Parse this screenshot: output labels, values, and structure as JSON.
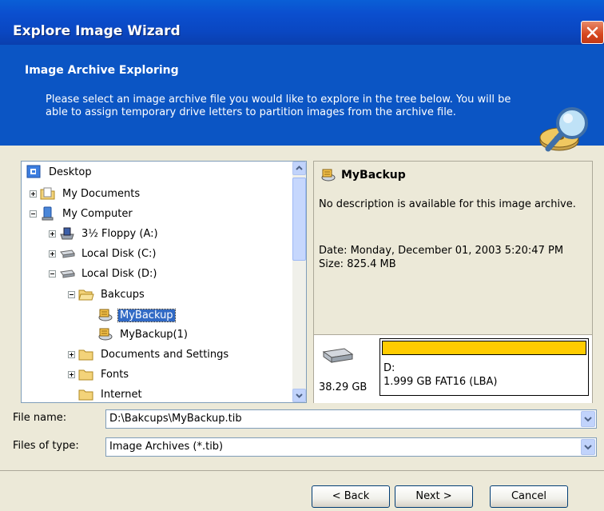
{
  "window": {
    "title": "Explore Image Wizard"
  },
  "header": {
    "title": "Image Archive Exploring",
    "description": "Please select an image archive file you would like to explore in the tree below. You will be able to assign temporary drive letters to partition images from the archive file."
  },
  "tree": {
    "items": [
      {
        "label": "Desktop",
        "icon": "desktop-icon"
      },
      {
        "label": "My Documents",
        "icon": "folder-icon",
        "expander": "plus"
      },
      {
        "label": "My Computer",
        "icon": "computer-icon",
        "expander": "minus"
      },
      {
        "label": "3½ Floppy (A:)",
        "icon": "floppy-icon",
        "expander": "plus"
      },
      {
        "label": "Local Disk (C:)",
        "icon": "drive-icon",
        "expander": "plus"
      },
      {
        "label": "Local Disk (D:)",
        "icon": "drive-icon",
        "expander": "minus"
      },
      {
        "label": "Bakcups",
        "icon": "folder-icon",
        "expander": "minus"
      },
      {
        "label": "MyBackup",
        "icon": "backup-archive-icon",
        "selected": true
      },
      {
        "label": "MyBackup(1)",
        "icon": "backup-archive-icon"
      },
      {
        "label": "Documents and Settings",
        "icon": "folder-icon",
        "expander": "plus"
      },
      {
        "label": "Fonts",
        "icon": "folder-icon",
        "expander": "plus"
      },
      {
        "label": "Internet",
        "icon": "folder-icon"
      }
    ]
  },
  "info": {
    "title": "MyBackup",
    "description": "No description is available for this image archive.",
    "date": "Date: Monday, December 01, 2003 5:20:47 PM",
    "size": "Size: 825.4 MB",
    "disk_capacity": "38.29 GB",
    "partition_letter": "D:",
    "partition_info": "1.999 GB  FAT16 (LBA)",
    "partition_color": "#ffcc00"
  },
  "form": {
    "file_name_label": "File name:",
    "file_name_value": "D:\\Bakcups\\MyBackup.tib",
    "file_type_label": "Files of type:",
    "file_type_value": "Image Archives (*.tib)"
  },
  "buttons": {
    "back": "< Back",
    "next": "Next >",
    "cancel": "Cancel"
  }
}
